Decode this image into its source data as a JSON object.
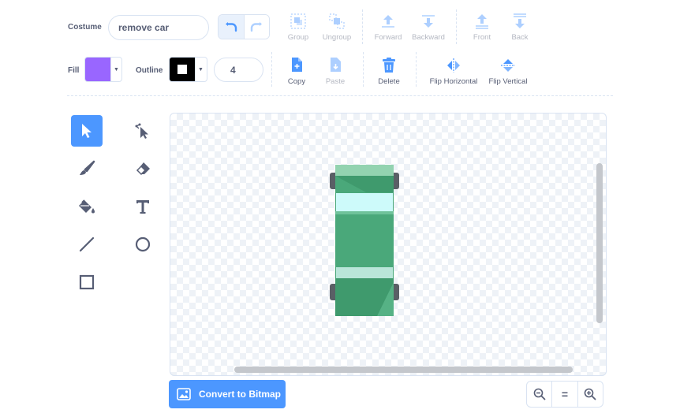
{
  "costume": {
    "label": "Costume",
    "name_value": "remove car"
  },
  "toolbar": {
    "group": "Group",
    "ungroup": "Ungroup",
    "forward": "Forward",
    "backward": "Backward",
    "front": "Front",
    "back": "Back",
    "copy": "Copy",
    "paste": "Paste",
    "delete": "Delete",
    "flip_horizontal": "Flip Horizontal",
    "flip_vertical": "Flip Vertical"
  },
  "fill": {
    "label": "Fill",
    "color": "#9966ff"
  },
  "outline": {
    "label": "Outline",
    "color": "#000000",
    "width": "4"
  },
  "tools": [
    {
      "name": "select",
      "icon": "arrow-icon",
      "selected": true
    },
    {
      "name": "reshape",
      "icon": "reshape-arrow-icon",
      "selected": false
    },
    {
      "name": "brush",
      "icon": "brush-icon",
      "selected": false
    },
    {
      "name": "eraser",
      "icon": "eraser-icon",
      "selected": false
    },
    {
      "name": "fill",
      "icon": "paint-bucket-icon",
      "selected": false
    },
    {
      "name": "text",
      "icon": "text-icon",
      "selected": false
    },
    {
      "name": "line",
      "icon": "line-icon",
      "selected": false
    },
    {
      "name": "circle",
      "icon": "circle-icon",
      "selected": false
    },
    {
      "name": "rectangle",
      "icon": "rectangle-icon",
      "selected": false
    }
  ],
  "convert_button": "Convert to Bitmap",
  "zoom": {
    "out": "zoom-out-icon",
    "reset": "=",
    "in": "zoom-in-icon"
  },
  "colors": {
    "accent": "#4c97ff",
    "text": "#575e75",
    "car_body": "#4aa87a",
    "car_window": "#cdfafa"
  }
}
